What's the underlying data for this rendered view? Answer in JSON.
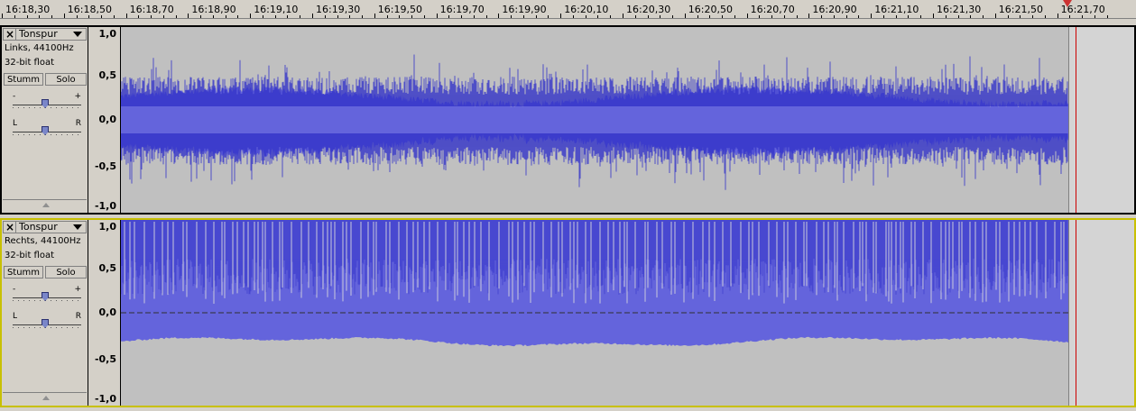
{
  "ruler": {
    "labels": [
      "16:18,30",
      "16:18,50",
      "16:18,70",
      "16:18,90",
      "16:19,10",
      "16:19,30",
      "16:19,50",
      "16:19,70",
      "16:19,90",
      "16:20,10",
      "16:20,30",
      "16:20,50",
      "16:20,70",
      "16:20,90",
      "16:21,10",
      "16:21,30",
      "16:21,50",
      "16:21,70"
    ]
  },
  "tracks": [
    {
      "name": "Tonspur",
      "channel_info": "Links, 44100Hz",
      "format": "32-bit float",
      "mute_label": "Stumm",
      "solo_label": "Solo",
      "gain_minus": "-",
      "gain_plus": "+",
      "pan_left": "L",
      "pan_right": "R",
      "scale": [
        "1,0",
        "0,5",
        "0,0",
        "-0,5",
        "-1,0"
      ]
    },
    {
      "name": "Tonspur",
      "channel_info": "Rechts, 44100Hz",
      "format": "32-bit float",
      "mute_label": "Stumm",
      "solo_label": "Solo",
      "gain_minus": "-",
      "gain_plus": "+",
      "pan_left": "L",
      "pan_right": "R",
      "scale": [
        "1,0",
        "0,5",
        "0,0",
        "-0,5",
        "-1,0"
      ]
    }
  ],
  "colors": {
    "wave_fill": "#6464dc",
    "wave_peak": "#3232c8",
    "selected_track_border": "#c8c000",
    "cursor": "#cc0000"
  },
  "icons": {
    "close": "close-icon",
    "menu": "dropdown-arrow-icon",
    "collapse": "collapse-arrow-icon",
    "playhead": "playhead-marker-icon"
  }
}
